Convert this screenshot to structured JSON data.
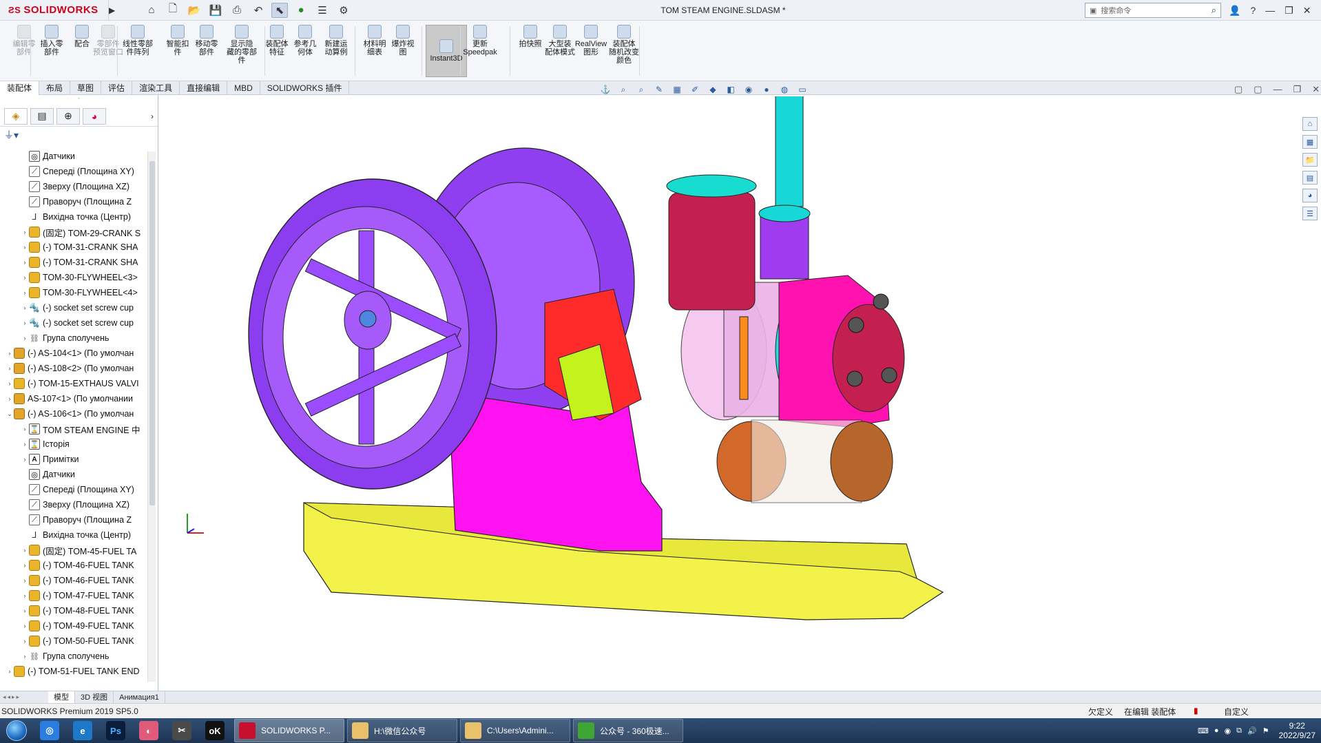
{
  "app": {
    "brand": "SOLIDWORKS",
    "window_title": "TOM STEAM ENGINE.SLDASM *"
  },
  "search": {
    "placeholder": "搜索命令"
  },
  "title_controls": [
    "?",
    "—",
    "❐",
    "✕"
  ],
  "ribbon": {
    "buttons": [
      {
        "label1": "编辑零",
        "label2": "部件",
        "disabled": true,
        "icon": "edit-component-icon"
      },
      {
        "label1": "插入零",
        "label2": "部件",
        "disabled": false,
        "icon": "insert-component-icon"
      },
      {
        "label1": "配合",
        "label2": "",
        "disabled": false,
        "icon": "mate-icon"
      },
      {
        "label1": "零部件",
        "label2": "预览窗口",
        "disabled": true,
        "icon": "component-preview-icon"
      },
      {
        "label1": "线性零部",
        "label2": "件阵列",
        "disabled": false,
        "icon": "linear-pattern-icon"
      },
      {
        "label1": "智能扣",
        "label2": "件",
        "disabled": false,
        "icon": "smart-fastener-icon"
      },
      {
        "label1": "移动零",
        "label2": "部件",
        "disabled": false,
        "icon": "move-component-icon"
      },
      {
        "label1": "显示隐",
        "label2": "藏的零部件",
        "disabled": false,
        "icon": "show-hidden-icon"
      },
      {
        "label1": "装配体",
        "label2": "特征",
        "disabled": false,
        "icon": "assembly-feature-icon"
      },
      {
        "label1": "参考几",
        "label2": "何体",
        "disabled": false,
        "icon": "reference-geometry-icon"
      },
      {
        "label1": "新建运",
        "label2": "动算例",
        "disabled": false,
        "icon": "motion-study-icon"
      },
      {
        "label1": "材料明",
        "label2": "细表",
        "disabled": false,
        "icon": "bom-icon"
      },
      {
        "label1": "爆炸视",
        "label2": "图",
        "disabled": false,
        "icon": "exploded-view-icon"
      },
      {
        "label1": "Instant3D",
        "label2": "",
        "disabled": false,
        "icon": "instant3d-icon",
        "active": true
      },
      {
        "label1": "更新",
        "label2": "Speedpak",
        "disabled": false,
        "icon": "speedpak-icon"
      },
      {
        "label1": "拍快照",
        "label2": "",
        "disabled": false,
        "icon": "snapshot-icon"
      },
      {
        "label1": "大型装",
        "label2": "配体模式",
        "disabled": false,
        "icon": "large-assembly-icon"
      },
      {
        "label1": "RealView",
        "label2": "图形",
        "disabled": false,
        "icon": "realview-icon"
      },
      {
        "label1": "装配体",
        "label2": "随机改变颜色",
        "disabled": false,
        "icon": "random-color-icon"
      }
    ]
  },
  "tabs": [
    "装配体",
    "布局",
    "草图",
    "评估",
    "渲染工具",
    "直接编辑",
    "MBD",
    "SOLIDWORKS 插件"
  ],
  "tree": [
    {
      "indent": 2,
      "arrow": "",
      "icon": "sensor",
      "label": "Датчики"
    },
    {
      "indent": 2,
      "arrow": "",
      "icon": "plane",
      "label": "Спереді (Площина XY)"
    },
    {
      "indent": 2,
      "arrow": "",
      "icon": "plane",
      "label": "Зверху (Площина XZ)"
    },
    {
      "indent": 2,
      "arrow": "",
      "icon": "plane",
      "label": "Праворуч (Площина Z"
    },
    {
      "indent": 2,
      "arrow": "",
      "icon": "origin",
      "label": "Вихідна точка (Центр)"
    },
    {
      "indent": 2,
      "arrow": "›",
      "icon": "part",
      "label": "(固定) TOM-29-CRANK S"
    },
    {
      "indent": 2,
      "arrow": "›",
      "icon": "part",
      "label": "(-) TOM-31-CRANK SHA"
    },
    {
      "indent": 2,
      "arrow": "›",
      "icon": "part",
      "label": "(-) TOM-31-CRANK SHA"
    },
    {
      "indent": 2,
      "arrow": "›",
      "icon": "part",
      "label": "TOM-30-FLYWHEEL<3>"
    },
    {
      "indent": 2,
      "arrow": "›",
      "icon": "part",
      "label": "TOM-30-FLYWHEEL<4>"
    },
    {
      "indent": 2,
      "arrow": "›",
      "icon": "screw",
      "label": "(-) socket set screw cup"
    },
    {
      "indent": 2,
      "arrow": "›",
      "icon": "screw",
      "label": "(-) socket set screw cup"
    },
    {
      "indent": 2,
      "arrow": "›",
      "icon": "mate",
      "label": "Група сполучень"
    },
    {
      "indent": 1,
      "arrow": "›",
      "icon": "asm",
      "label": "(-) AS-104<1> (По умолчан"
    },
    {
      "indent": 1,
      "arrow": "›",
      "icon": "asm",
      "label": "(-) AS-108<2> (По умолчан"
    },
    {
      "indent": 1,
      "arrow": "›",
      "icon": "part",
      "label": "(-) TOM-15-EXTHAUS VALVI"
    },
    {
      "indent": 1,
      "arrow": "›",
      "icon": "asm",
      "label": "AS-107<1> (По умолчании"
    },
    {
      "indent": 1,
      "arrow": "⌄",
      "icon": "asm",
      "label": "(-) AS-106<1> (По умолчан"
    },
    {
      "indent": 2,
      "arrow": "›",
      "icon": "hist",
      "label": "TOM STEAM ENGINE 中"
    },
    {
      "indent": 2,
      "arrow": "›",
      "icon": "hist",
      "label": "Історія"
    },
    {
      "indent": 2,
      "arrow": "›",
      "icon": "note",
      "label": "Примітки"
    },
    {
      "indent": 2,
      "arrow": "",
      "icon": "sensor",
      "label": "Датчики"
    },
    {
      "indent": 2,
      "arrow": "",
      "icon": "plane",
      "label": "Спереді (Площина XY)"
    },
    {
      "indent": 2,
      "arrow": "",
      "icon": "plane",
      "label": "Зверху (Площина XZ)"
    },
    {
      "indent": 2,
      "arrow": "",
      "icon": "plane",
      "label": "Праворуч (Площина Z"
    },
    {
      "indent": 2,
      "arrow": "",
      "icon": "origin",
      "label": "Вихідна точка (Центр)"
    },
    {
      "indent": 2,
      "arrow": "›",
      "icon": "part",
      "label": "(固定) TOM-45-FUEL TA"
    },
    {
      "indent": 2,
      "arrow": "›",
      "icon": "part",
      "label": "(-) TOM-46-FUEL TANK"
    },
    {
      "indent": 2,
      "arrow": "›",
      "icon": "part",
      "label": "(-) TOM-46-FUEL TANK"
    },
    {
      "indent": 2,
      "arrow": "›",
      "icon": "part",
      "label": "(-) TOM-47-FUEL TANK"
    },
    {
      "indent": 2,
      "arrow": "›",
      "icon": "part",
      "label": "(-) TOM-48-FUEL TANK"
    },
    {
      "indent": 2,
      "arrow": "›",
      "icon": "part",
      "label": "(-) TOM-49-FUEL TANK"
    },
    {
      "indent": 2,
      "arrow": "›",
      "icon": "part",
      "label": "(-) TOM-50-FUEL TANK"
    },
    {
      "indent": 2,
      "arrow": "›",
      "icon": "mate",
      "label": "Група сполучень"
    },
    {
      "indent": 1,
      "arrow": "›",
      "icon": "part",
      "label": "(-) TOM-51-FUEL TANK END"
    }
  ],
  "bottom_tabs": [
    "模型",
    "3D 视图",
    "Анимация1"
  ],
  "status": {
    "left": "SOLIDWORKS Premium 2019 SP5.0",
    "underdefined": "欠定义",
    "editing": "在编辑 装配体",
    "custom": "自定义"
  },
  "taskbar": {
    "apps": [
      {
        "label": "SOLIDWORKS P...",
        "color": "#c8102e",
        "active": true
      },
      {
        "label": "H:\\微信公众号",
        "color": "#e8c16a",
        "active": false
      },
      {
        "label": "C:\\Users\\Admini...",
        "color": "#e8c16a",
        "active": false
      },
      {
        "label": "公众号 - 360极速...",
        "color": "#3fa535",
        "active": false
      }
    ],
    "time": "9:22",
    "date": "2022/9/27"
  },
  "colors": {
    "flywheel": "#9b4cff",
    "base": "#f2f24a",
    "frame": "#ff12f0",
    "chimney": "#17d7d7",
    "cylinder_cap": "#c3204f",
    "red_part": "#ff2a2a"
  }
}
